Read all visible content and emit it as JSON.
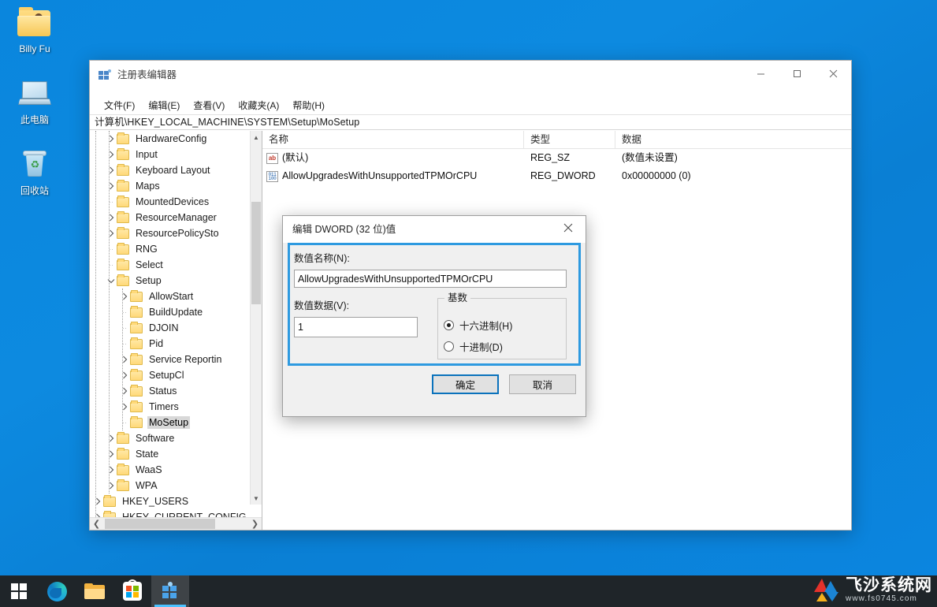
{
  "desktop": {
    "icons": [
      {
        "label": "Billy Fu",
        "icon": "user-folder-icon"
      },
      {
        "label": "此电脑",
        "icon": "this-pc-icon"
      },
      {
        "label": "回收站",
        "icon": "recycle-bin-icon"
      }
    ]
  },
  "regedit": {
    "title": "注册表编辑器",
    "menu": [
      "文件(F)",
      "编辑(E)",
      "查看(V)",
      "收藏夹(A)",
      "帮助(H)"
    ],
    "address": "计算机\\HKEY_LOCAL_MACHINE\\SYSTEM\\Setup\\MoSetup",
    "window_buttons": {
      "minimize": "minimize-button",
      "maximize": "maximize-button",
      "close": "close-button"
    },
    "tree": [
      {
        "label": "HardwareConfig",
        "depth": 2,
        "expander": "collapsed"
      },
      {
        "label": "Input",
        "depth": 2,
        "expander": "collapsed"
      },
      {
        "label": "Keyboard Layout",
        "depth": 2,
        "expander": "collapsed"
      },
      {
        "label": "Maps",
        "depth": 2,
        "expander": "collapsed"
      },
      {
        "label": "MountedDevices",
        "depth": 2,
        "expander": "leaf"
      },
      {
        "label": "ResourceManager",
        "depth": 2,
        "expander": "collapsed"
      },
      {
        "label": "ResourcePolicySto",
        "depth": 2,
        "expander": "collapsed"
      },
      {
        "label": "RNG",
        "depth": 2,
        "expander": "leaf"
      },
      {
        "label": "Select",
        "depth": 2,
        "expander": "leaf"
      },
      {
        "label": "Setup",
        "depth": 2,
        "expander": "expanded"
      },
      {
        "label": "AllowStart",
        "depth": 3,
        "expander": "collapsed"
      },
      {
        "label": "BuildUpdate",
        "depth": 3,
        "expander": "leaf"
      },
      {
        "label": "DJOIN",
        "depth": 3,
        "expander": "leaf"
      },
      {
        "label": "Pid",
        "depth": 3,
        "expander": "leaf"
      },
      {
        "label": "Service Reportin",
        "depth": 3,
        "expander": "collapsed"
      },
      {
        "label": "SetupCl",
        "depth": 3,
        "expander": "collapsed"
      },
      {
        "label": "Status",
        "depth": 3,
        "expander": "collapsed"
      },
      {
        "label": "Timers",
        "depth": 3,
        "expander": "collapsed"
      },
      {
        "label": "MoSetup",
        "depth": 3,
        "expander": "leaf",
        "selected": true
      },
      {
        "label": "Software",
        "depth": 2,
        "expander": "collapsed"
      },
      {
        "label": "State",
        "depth": 2,
        "expander": "collapsed"
      },
      {
        "label": "WaaS",
        "depth": 2,
        "expander": "collapsed"
      },
      {
        "label": "WPA",
        "depth": 2,
        "expander": "collapsed"
      },
      {
        "label": "HKEY_USERS",
        "depth": 1,
        "expander": "collapsed"
      },
      {
        "label": "HKEY_CURRENT_CONFIG",
        "depth": 1,
        "expander": "collapsed"
      }
    ],
    "list": {
      "columns": [
        "名称",
        "类型",
        "数据"
      ],
      "rows": [
        {
          "icon": "reg-sz-icon",
          "name": "(默认)",
          "type": "REG_SZ",
          "data": "(数值未设置)"
        },
        {
          "icon": "reg-dword-icon",
          "name": "AllowUpgradesWithUnsupportedTPMOrCPU",
          "type": "REG_DWORD",
          "data": "0x00000000 (0)"
        }
      ]
    }
  },
  "dialog": {
    "title": "编辑 DWORD (32 位)值",
    "close_icon": "close-icon",
    "name_label": "数值名称(N):",
    "name_value": "AllowUpgradesWithUnsupportedTPMOrCPU",
    "data_label": "数值数据(V):",
    "data_value": "1",
    "base_group_label": "基数",
    "radios": [
      {
        "label": "十六进制(H)",
        "selected": true
      },
      {
        "label": "十进制(D)",
        "selected": false
      }
    ],
    "ok_label": "确定",
    "cancel_label": "取消"
  },
  "taskbar": {
    "items": [
      {
        "name": "start-button",
        "icon": "windows-logo-icon"
      },
      {
        "name": "edge-button",
        "icon": "edge-icon"
      },
      {
        "name": "file-explorer-button",
        "icon": "folder-icon"
      },
      {
        "name": "microsoft-store-button",
        "icon": "store-icon"
      },
      {
        "name": "regedit-taskbar-button",
        "icon": "registry-editor-icon",
        "active": true
      }
    ]
  },
  "watermark": {
    "brand_cn": "飞沙系统网",
    "brand_url": "www.fs0745.com"
  },
  "colors": {
    "accent": "#0a72bc",
    "focus_border": "#2e9ae0",
    "taskbar": "#1f2529",
    "desktop": "#0d8ae0"
  }
}
